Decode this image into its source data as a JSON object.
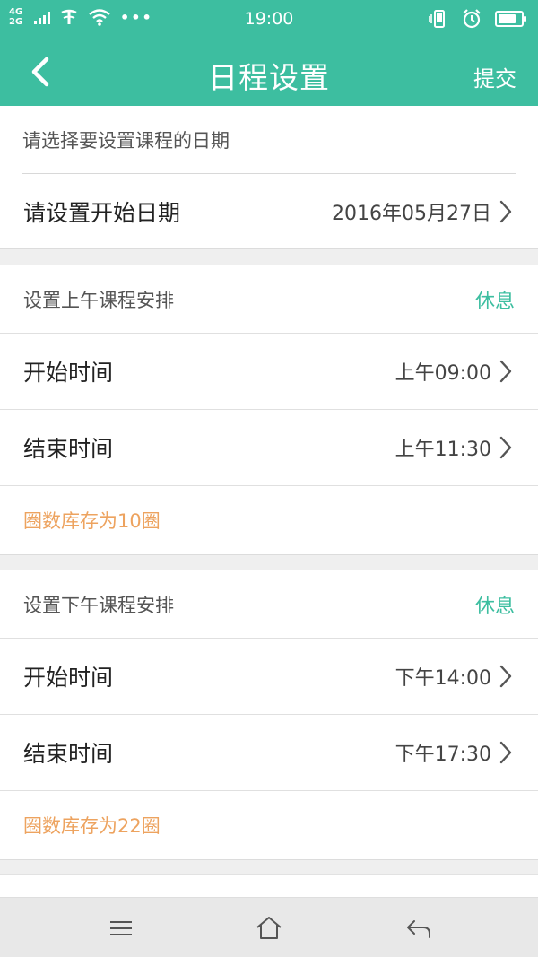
{
  "status_bar": {
    "network_top": "4G",
    "network_bottom": "2G",
    "time": "19:00",
    "icons": [
      "signal-icon",
      "carrier-icon",
      "wifi-icon",
      "more-dots-icon",
      "vibrate-icon",
      "alarm-icon",
      "battery-icon"
    ]
  },
  "header": {
    "title": "日程设置",
    "submit_label": "提交",
    "back_icon": "back-chevron-icon"
  },
  "date_section": {
    "prompt": "请选择要设置课程的日期",
    "start_date_label": "请设置开始日期",
    "start_date_value": "2016年05月27日"
  },
  "morning": {
    "title": "设置上午课程安排",
    "action": "休息",
    "start_label": "开始时间",
    "start_value": "上午09:00",
    "end_label": "结束时间",
    "end_value": "上午11:30",
    "note": "圈数库存为10圈"
  },
  "afternoon": {
    "title": "设置下午课程安排",
    "action": "休息",
    "start_label": "开始时间",
    "start_value": "下午14:00",
    "end_label": "结束时间",
    "end_value": "下午17:30",
    "note": "圈数库存为22圈"
  },
  "nav_bar": {
    "icons": [
      "menu-icon",
      "home-icon",
      "back-arrow-icon"
    ]
  },
  "colors": {
    "accent": "#3dbea0",
    "note": "#eda35f"
  }
}
